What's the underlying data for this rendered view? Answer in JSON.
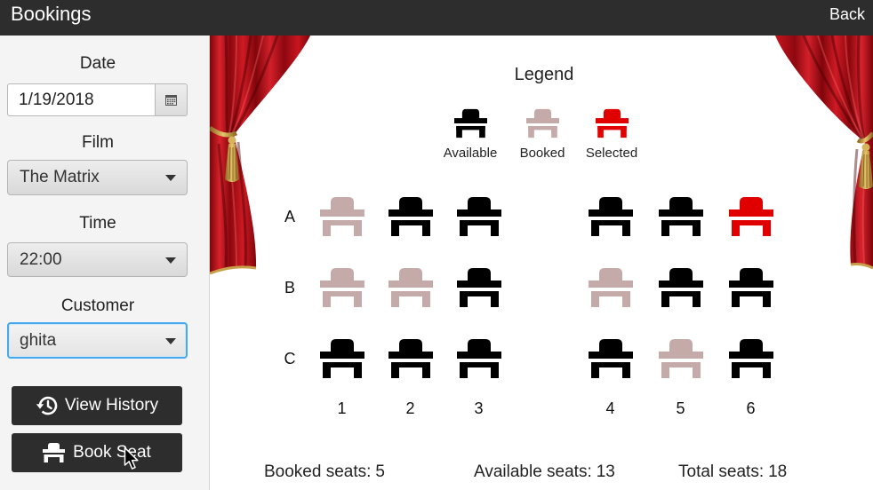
{
  "header": {
    "title": "Bookings",
    "back_label": "Back"
  },
  "sidebar": {
    "date": {
      "label": "Date",
      "value": "1/19/2018"
    },
    "film": {
      "label": "Film",
      "value": "The Matrix"
    },
    "time": {
      "label": "Time",
      "value": "22:00"
    },
    "customer": {
      "label": "Customer",
      "value": "ghita"
    },
    "buttons": {
      "view_history": "View History",
      "book_seat": "Book Seat"
    }
  },
  "icons": {
    "calendar": "calendar-icon",
    "dropdown": "chevron-down-icon",
    "history": "history-icon",
    "seat": "seat-icon",
    "cursor": "mouse-cursor-icon"
  },
  "theme": {
    "header_bg": "#2d2d2d",
    "button_bg": "#2d2d2d",
    "focus": "#48a8ec",
    "available": "#000000",
    "booked": "#c4aaa8",
    "selected": "#e00000",
    "curtain": "#c8151f",
    "tassel": "#d6b35d"
  },
  "legend": {
    "title": "Legend",
    "items": [
      {
        "status": "available",
        "label": "Available"
      },
      {
        "status": "booked",
        "label": "Booked"
      },
      {
        "status": "selected",
        "label": "Selected"
      }
    ]
  },
  "seating": {
    "columns": [
      "1",
      "2",
      "3",
      "4",
      "5",
      "6"
    ],
    "rows": [
      {
        "label": "A",
        "seats": [
          "booked",
          "available",
          "available",
          "available",
          "available",
          "selected"
        ]
      },
      {
        "label": "B",
        "seats": [
          "booked",
          "booked",
          "available",
          "booked",
          "available",
          "available"
        ]
      },
      {
        "label": "C",
        "seats": [
          "available",
          "available",
          "available",
          "available",
          "booked",
          "available"
        ]
      }
    ]
  },
  "stats": {
    "booked_label": "Booked seats:",
    "booked_value": 5,
    "available_label": "Available seats:",
    "available_value": 13,
    "total_label": "Total seats:",
    "total_value": 18
  }
}
